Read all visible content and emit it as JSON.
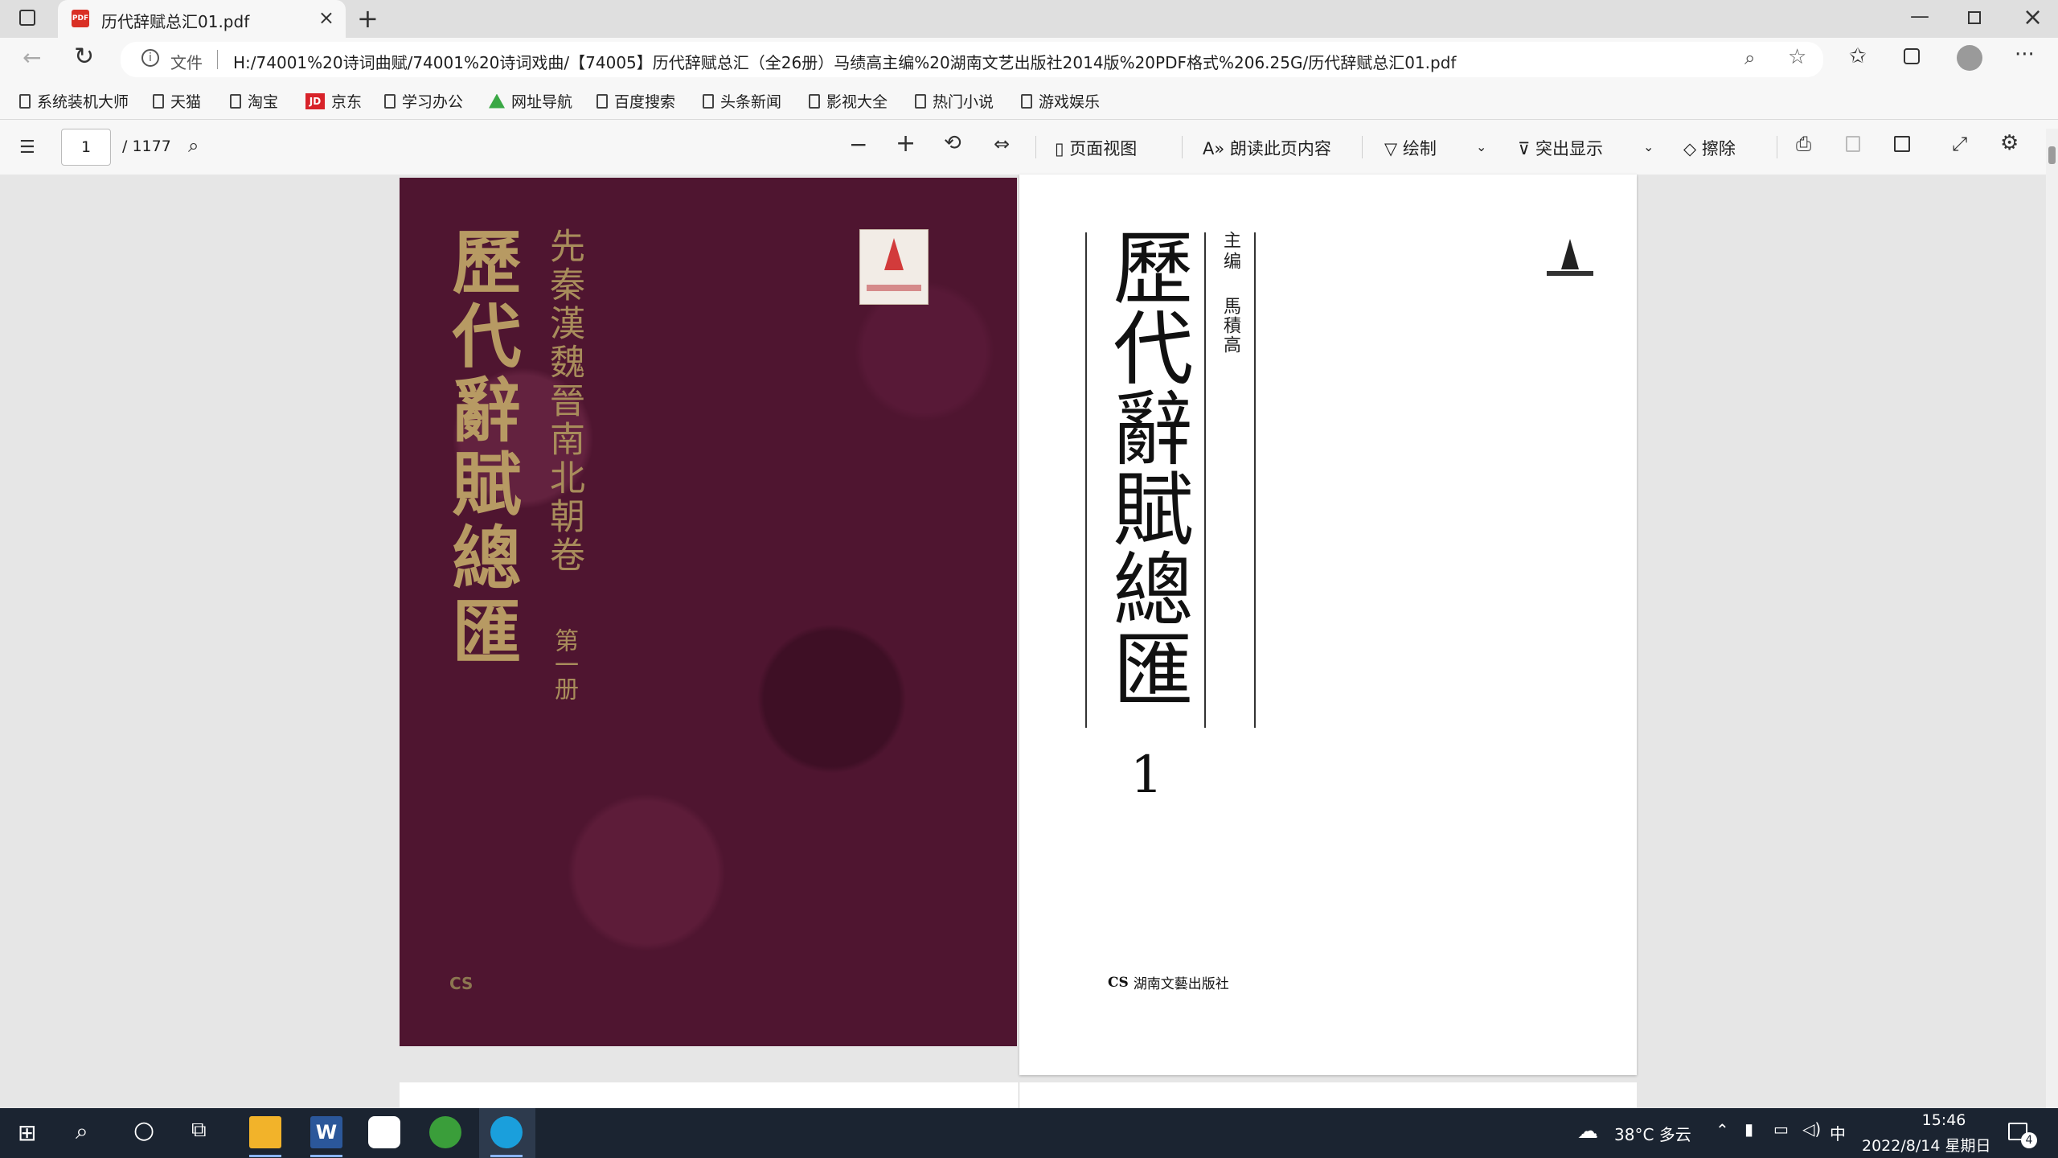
{
  "browser": {
    "tab": {
      "title": "历代辞赋总汇01.pdf",
      "badge": "PDF"
    },
    "address": {
      "file_label": "文件",
      "url": "H:/74001%20诗词曲赋/74001%20诗词戏曲/【74005】历代辞赋总汇（全26册）马绩高主编%20湖南文艺出版社2014版%20PDF格式%206.25G/历代辞赋总汇01.pdf"
    },
    "bookmarks": [
      "系统装机大师",
      "天猫",
      "淘宝",
      "京东",
      "学习办公",
      "网址导航",
      "百度搜索",
      "头条新闻",
      "影视大全",
      "热门小说",
      "游戏娱乐"
    ],
    "jd_badge": "JD"
  },
  "pdf_toolbar": {
    "page_current": "1",
    "page_total": "/ 1177",
    "page_view": "页面视图",
    "read_aloud": "朗读此页内容",
    "draw": "绘制",
    "highlight": "突出显示",
    "erase": "擦除"
  },
  "document": {
    "cover_title": "歷代辭賦總匯",
    "cover_subtitle": "先秦漢魏晉南北朝卷",
    "cover_volume": "第一册",
    "title_page_title": "歷代辭賦總匯",
    "editor_role": "主编",
    "editor_name": "馬積高",
    "volume_number": "1",
    "publisher": "湖南文藝出版社",
    "publisher_mark": "CS"
  },
  "taskbar": {
    "weather": "38°C 多云",
    "ime": "中",
    "time": "15:46",
    "date": "2022/8/14 星期日",
    "notification_count": "4"
  },
  "colors": {
    "cover": "#4f1530",
    "cover_text": "#b79a63",
    "accent": "#0078d4"
  }
}
